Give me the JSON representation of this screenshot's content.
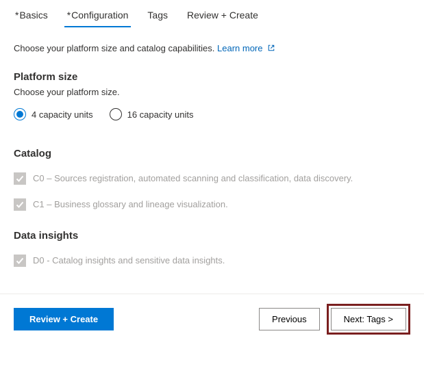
{
  "tabs": {
    "basics": "Basics",
    "configuration": "Configuration",
    "tags": "Tags",
    "review": "Review + Create"
  },
  "intro": {
    "text": "Choose your platform size and catalog capabilities.",
    "link": "Learn more"
  },
  "platform": {
    "title": "Platform size",
    "sub": "Choose your platform size.",
    "option1": "4 capacity units",
    "option2": "16 capacity units"
  },
  "catalog": {
    "title": "Catalog",
    "c0": "C0 – Sources registration, automated scanning and classification, data discovery.",
    "c1": "C1 – Business glossary and lineage visualization."
  },
  "insights": {
    "title": "Data insights",
    "d0": "D0 - Catalog insights and sensitive data insights."
  },
  "footer": {
    "review": "Review + Create",
    "previous": "Previous",
    "next": "Next: Tags >"
  }
}
